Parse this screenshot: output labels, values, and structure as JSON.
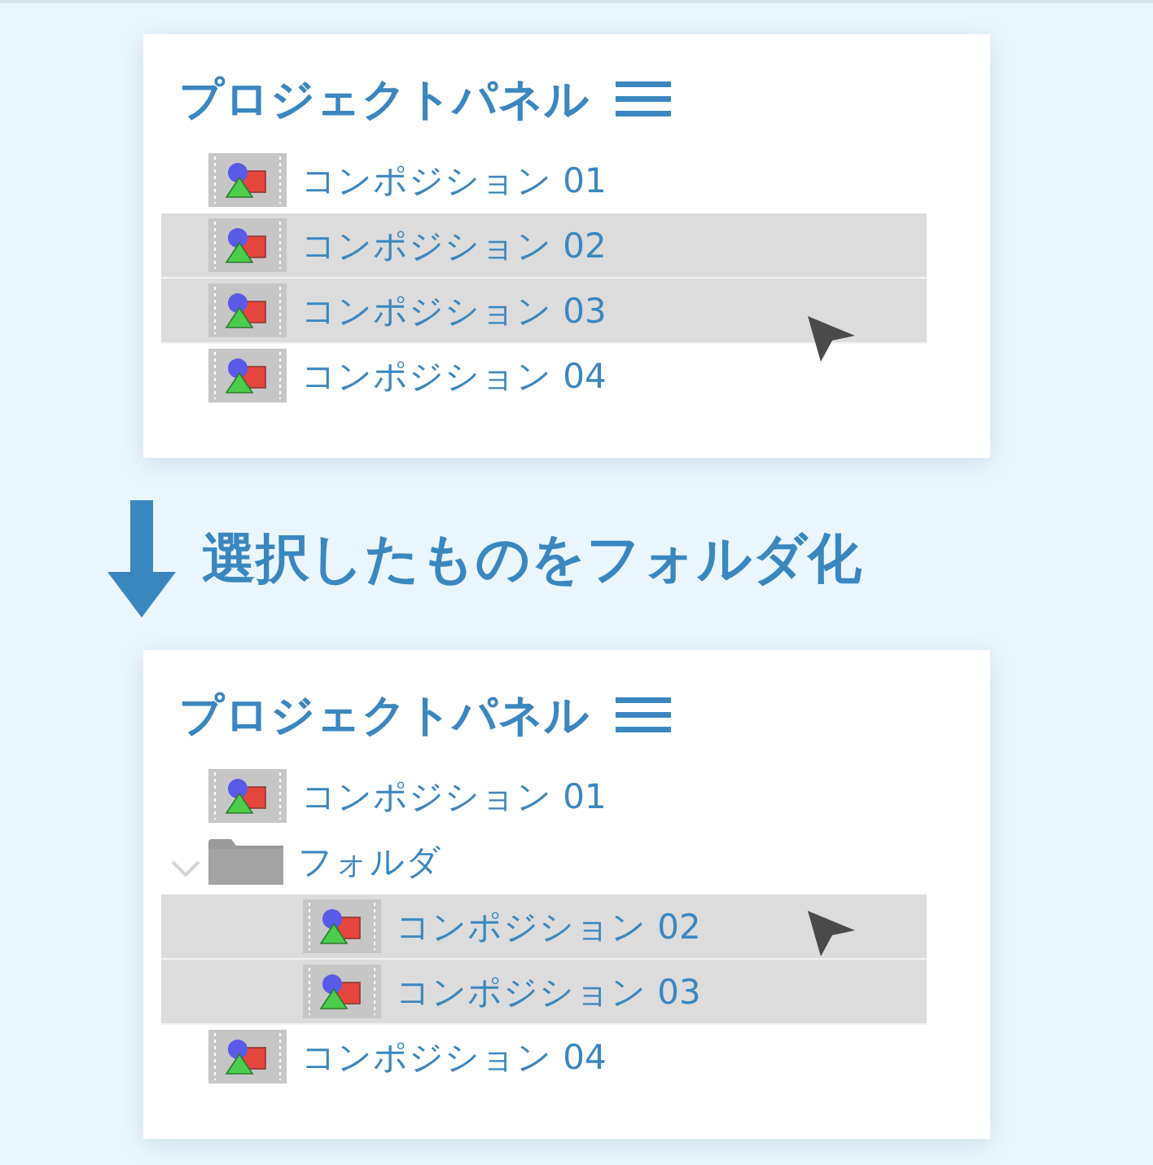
{
  "panels": [
    {
      "title": "プロジェクトパネル",
      "items": [
        {
          "kind": "composition",
          "label": "コンポジション 01",
          "selected": false
        },
        {
          "kind": "composition",
          "label": "コンポジション 02",
          "selected": true
        },
        {
          "kind": "composition",
          "label": "コンポジション 03",
          "selected": true
        },
        {
          "kind": "composition",
          "label": "コンポジション 04",
          "selected": false
        }
      ]
    },
    {
      "title": "プロジェクトパネル",
      "items": [
        {
          "kind": "composition",
          "label": "コンポジション 01",
          "selected": false
        },
        {
          "kind": "folder",
          "label": "フォルダ",
          "selected": false,
          "expanded": true,
          "children": [
            {
              "kind": "composition",
              "label": "コンポジション 02",
              "selected": true
            },
            {
              "kind": "composition",
              "label": "コンポジション 03",
              "selected": true
            }
          ]
        },
        {
          "kind": "composition",
          "label": "コンポジション 04",
          "selected": false
        }
      ]
    }
  ],
  "caption": "選択したものをフォルダ化"
}
